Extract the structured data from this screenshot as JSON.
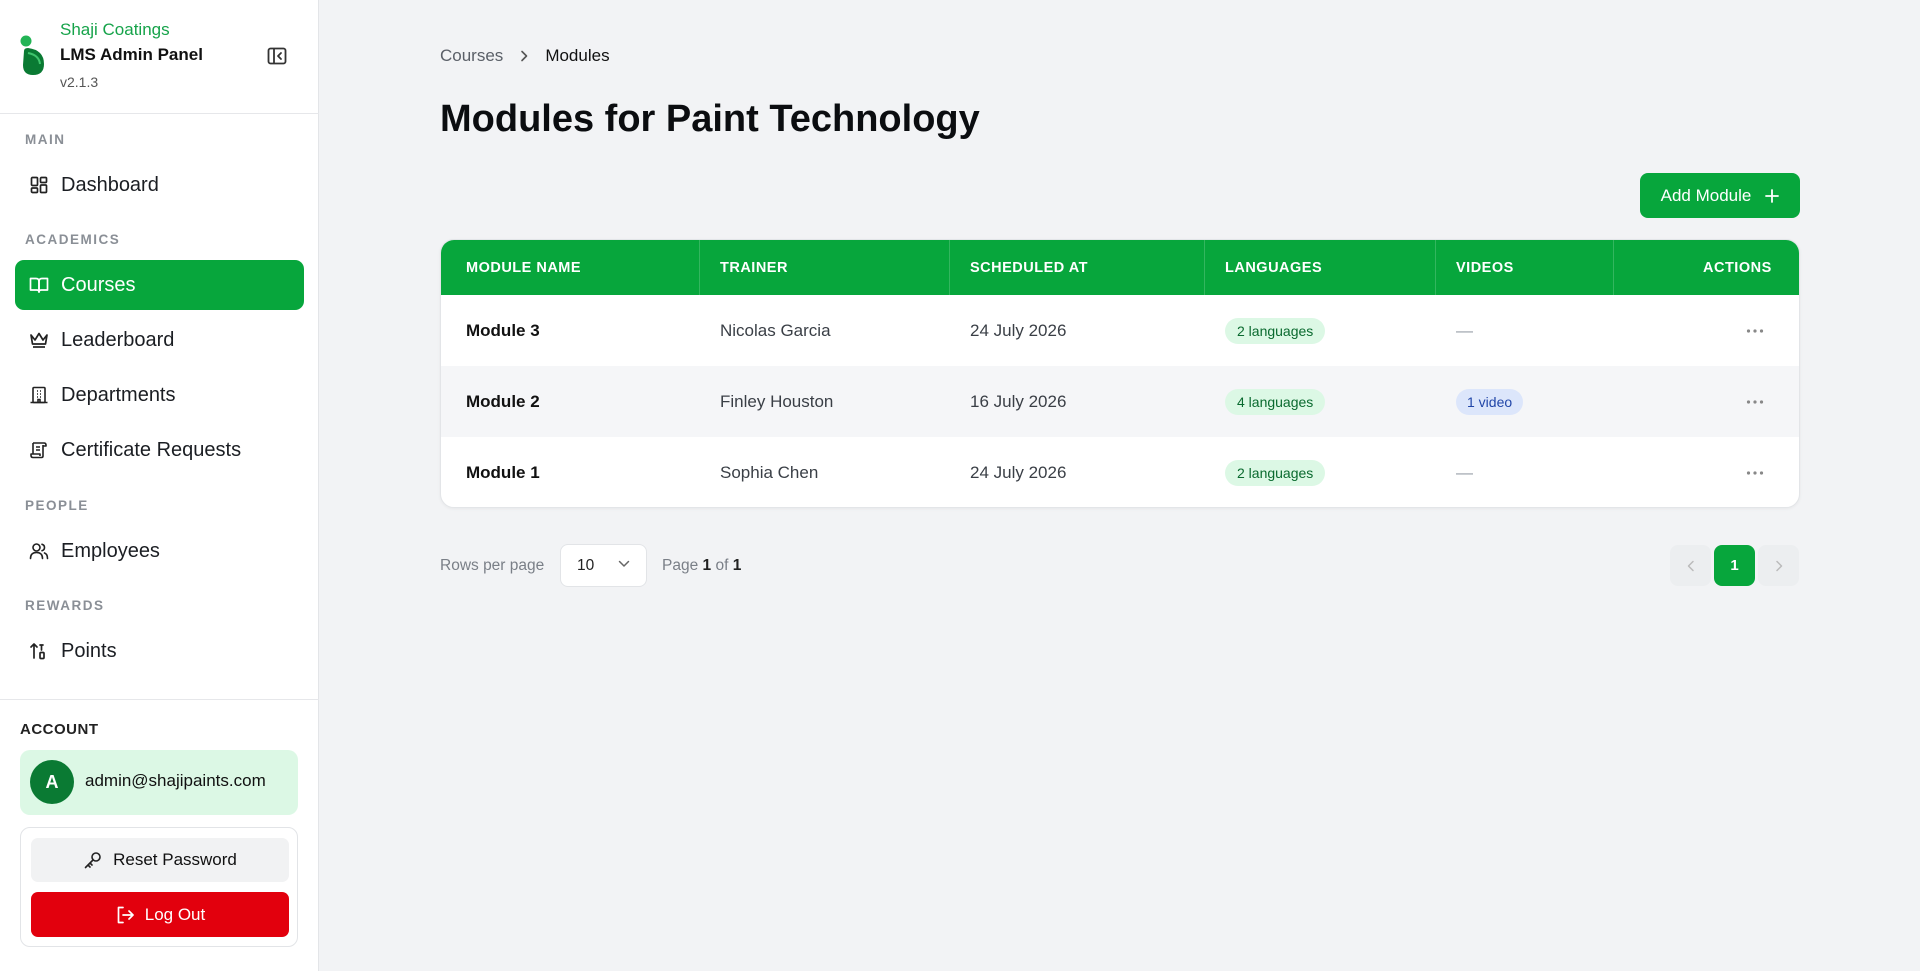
{
  "brand": {
    "company": "Shaji Coatings",
    "app_name": "LMS Admin Panel",
    "version": "v2.1.3",
    "accent_color": "#07a63c"
  },
  "sidebar": {
    "sections": [
      {
        "label": "MAIN"
      },
      {
        "label": "ACADEMICS"
      },
      {
        "label": "PEOPLE"
      },
      {
        "label": "REWARDS"
      }
    ],
    "items": [
      {
        "label": "Dashboard",
        "icon": "dashboard-grid-icon"
      },
      {
        "label": "Courses",
        "icon": "book-open-icon",
        "active": true
      },
      {
        "label": "Leaderboard",
        "icon": "crown-icon"
      },
      {
        "label": "Departments",
        "icon": "building-icon"
      },
      {
        "label": "Certificate Requests",
        "icon": "scroll-icon"
      },
      {
        "label": "Employees",
        "icon": "users-icon"
      },
      {
        "label": "Points",
        "icon": "sort-arrows-icon"
      }
    ]
  },
  "account": {
    "label": "ACCOUNT",
    "avatar_initial": "A",
    "email": "admin@shajipaints.com",
    "reset_password_label": "Reset Password",
    "logout_label": "Log Out"
  },
  "breadcrumb": {
    "parent": "Courses",
    "current": "Modules"
  },
  "page": {
    "title": "Modules for Paint Technology",
    "add_button_label": "Add Module"
  },
  "table": {
    "columns": [
      "MODULE NAME",
      "TRAINER",
      "SCHEDULED AT",
      "LANGUAGES",
      "VIDEOS",
      "ACTIONS"
    ],
    "rows": [
      {
        "module_name": "Module 3",
        "trainer": "Nicolas Garcia",
        "scheduled_at": "24 July 2026",
        "languages": "2 languages",
        "videos": "—"
      },
      {
        "module_name": "Module 2",
        "trainer": "Finley Houston",
        "scheduled_at": "16 July 2026",
        "languages": "4 languages",
        "videos": "1 video"
      },
      {
        "module_name": "Module 1",
        "trainer": "Sophia Chen",
        "scheduled_at": "24 July 2026",
        "languages": "2 languages",
        "videos": "—"
      }
    ]
  },
  "pagination": {
    "rows_per_page_label": "Rows per page",
    "rows_per_page_value": "10",
    "page_prefix": "Page",
    "current_page": "1",
    "of_label": "of",
    "total_pages": "1"
  }
}
